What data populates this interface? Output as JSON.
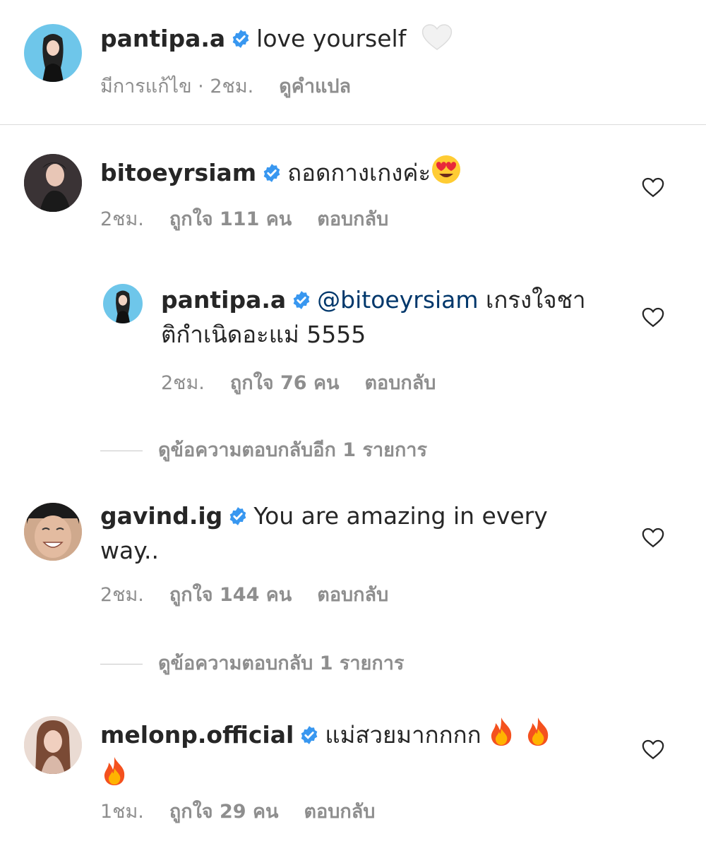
{
  "caption": {
    "username": "pantipa.a",
    "text": "love yourself",
    "edited": "มีการแก้ไข · 2ชม.",
    "translate": "ดูคำแปล"
  },
  "comments": [
    {
      "username": "bitoeyrsiam",
      "text": "ถอดกางเกงค่ะ",
      "time": "2ชม.",
      "likes": "ถูกใจ 111 คน",
      "reply": "ตอบกลับ"
    },
    {
      "username": "pantipa.a",
      "mention": "@bitoeyrsiam",
      "text_line1": "เกรงใจชา",
      "text_line2": "ติกำเนิดอะแม่ 5555",
      "time": "2ชม.",
      "likes": "ถูกใจ 76 คน",
      "reply": "ตอบกลับ"
    },
    {
      "username": "gavind.ig",
      "text_line1": "You are amazing in every",
      "text_line2": "way..",
      "time": "2ชม.",
      "likes": "ถูกใจ 144 คน",
      "reply": "ตอบกลับ"
    },
    {
      "username": "melonp.official",
      "text": "แม่สวยมากกกก",
      "time": "1ชม.",
      "likes": "ถูกใจ 29 คน",
      "reply": "ตอบกลับ"
    }
  ],
  "view_replies_1": "ดูข้อความตอบกลับอีก 1 รายการ",
  "view_replies_2": "ดูข้อความตอบกลับ 1 รายการ",
  "icons": {
    "verified": "verified-badge-icon",
    "heart": "heart-outline-icon",
    "white_heart": "white-heart-emoji",
    "fire": "fire-emoji",
    "heart_eyes": "heart-eyes-emoji"
  },
  "colors": {
    "verified": "#3897f0",
    "mention": "#00376b",
    "secondary": "#8e8e8e"
  }
}
